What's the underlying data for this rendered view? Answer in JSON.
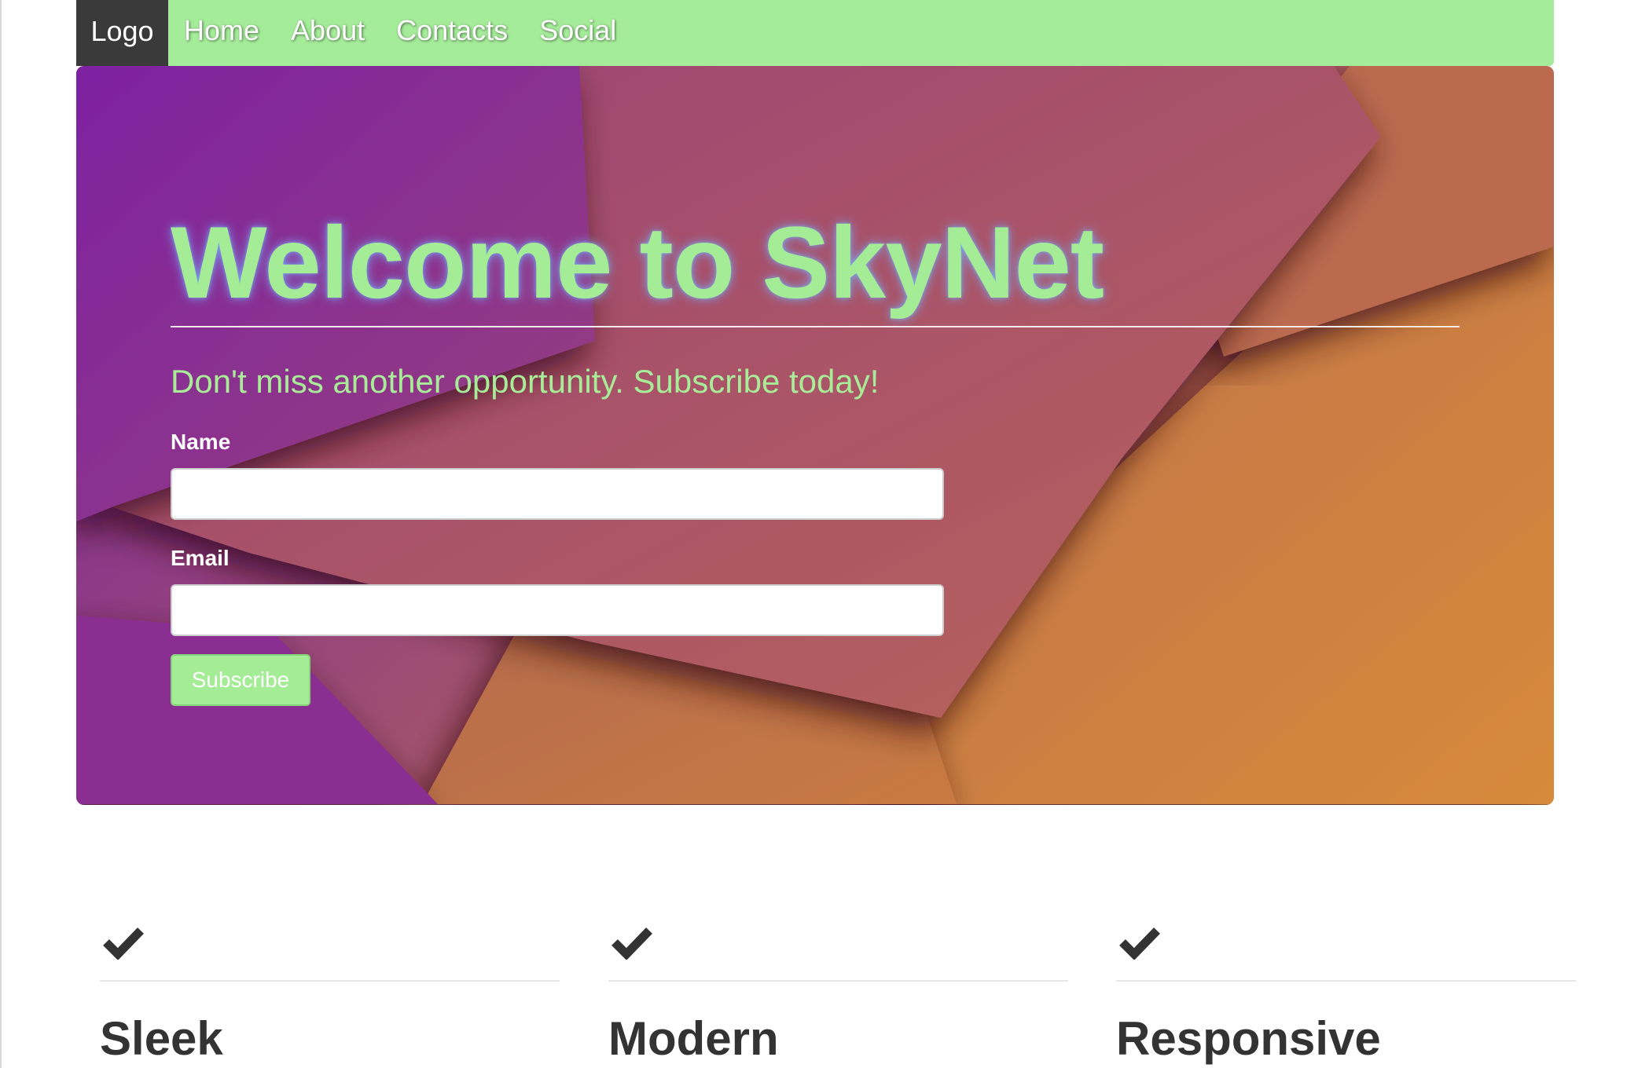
{
  "nav": {
    "logo": "Logo",
    "links": [
      "Home",
      "About",
      "Contacts",
      "Social"
    ]
  },
  "hero": {
    "title": "Welcome to SkyNet",
    "subtitle": "Don't miss another opportunity. Subscribe today!",
    "form": {
      "name_label": "Name",
      "name_value": "",
      "email_label": "Email",
      "email_value": "",
      "submit_label": "Subscribe"
    }
  },
  "features": [
    {
      "icon": "checkmark-icon",
      "title": "Sleek"
    },
    {
      "icon": "checkmark-icon",
      "title": "Modern"
    },
    {
      "icon": "checkmark-icon",
      "title": "Responsive"
    }
  ],
  "colors": {
    "navbar": "#a5ec9a",
    "logo_bg": "#3a3a3a",
    "accent": "#a4ec95"
  }
}
